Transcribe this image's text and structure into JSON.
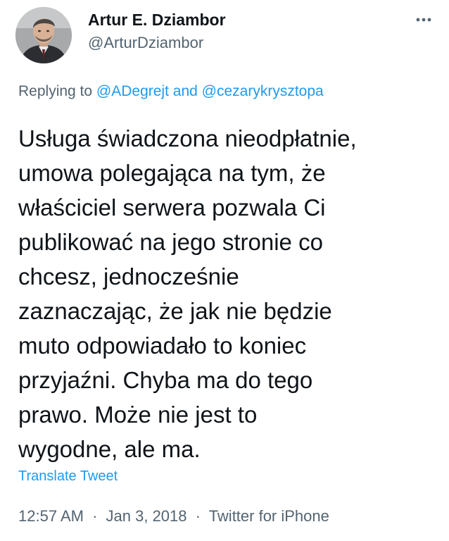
{
  "author": {
    "display_name": "Artur E. Dziambor",
    "handle": "@ArturDziambor"
  },
  "icons": {
    "more": "more-horizontal-icon",
    "avatar": "profile-photo"
  },
  "reply": {
    "prefix": "Replying to",
    "mention_1": "@ADegrejt",
    "conjunction": "and",
    "mention_2": "@cezarykrysztopa"
  },
  "tweet_lines": [
    "Usługa świadczona nieodpłatnie,",
    "umowa polegająca na tym, że",
    "właściciel serwera pozwala Ci",
    "publikować na jego stronie co",
    "chcesz, jednocześnie",
    "zaznaczając, że jak nie będzie",
    "muto odpowiadało to koniec",
    "przyjaźni. Chyba ma do tego",
    "prawo. Może nie jest to",
    "wygodne, ale ma."
  ],
  "translate_label": "Translate Tweet",
  "meta": {
    "time": "12:57 AM",
    "separator": "·",
    "date": "Jan 3, 2018",
    "source": "Twitter for iPhone"
  },
  "colors": {
    "link": "#1d9bf0",
    "secondary_text": "#536471",
    "primary_text": "#0f1419",
    "background": "#ffffff"
  }
}
